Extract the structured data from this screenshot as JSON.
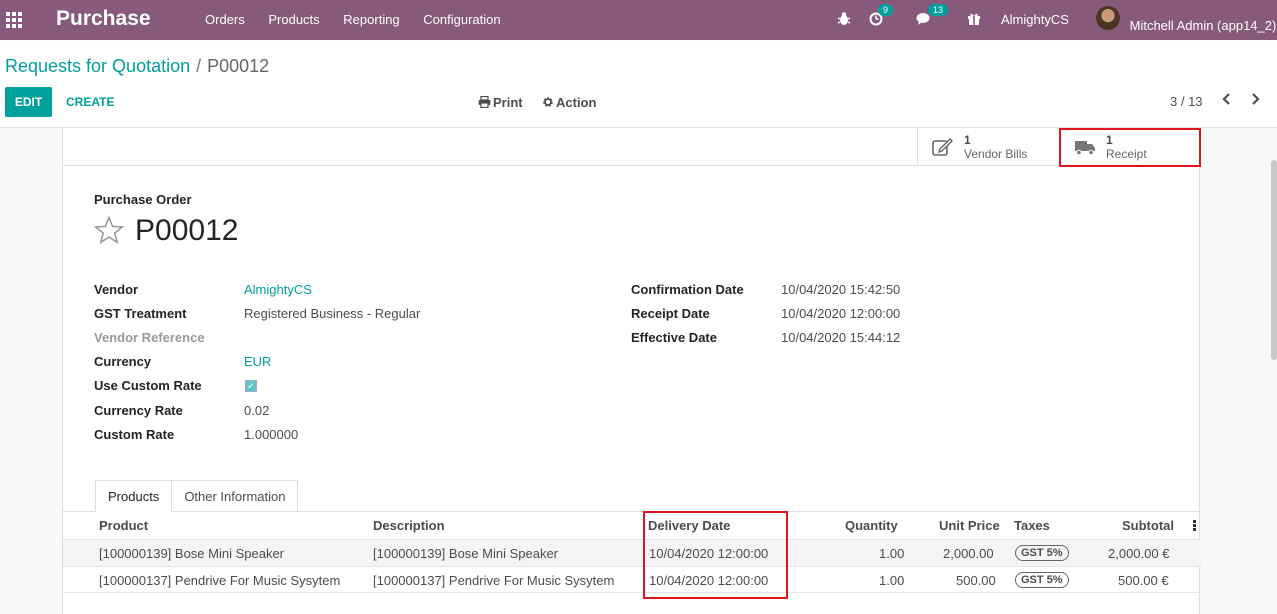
{
  "navbar": {
    "app_name": "Purchase",
    "menu": [
      "Orders",
      "Products",
      "Reporting",
      "Configuration"
    ],
    "activity_badge": "9",
    "messages_badge": "13",
    "company": "AlmightyCS",
    "user": "Mitchell Admin (app14_2)"
  },
  "breadcrumb": {
    "parent": "Requests for Quotation",
    "separator": "/",
    "current": "P00012"
  },
  "toolbar": {
    "edit": "EDIT",
    "create": "CREATE",
    "print": "Print",
    "action": "Action",
    "pager": "3 / 13"
  },
  "smart_buttons": {
    "vendor_bills": {
      "count": "1",
      "label": "Vendor Bills"
    },
    "receipt": {
      "count": "1",
      "label": "Receipt"
    }
  },
  "form": {
    "title_label": "Purchase Order",
    "name": "P00012",
    "left_fields": {
      "vendor": {
        "label": "Vendor",
        "value": "AlmightyCS"
      },
      "gst": {
        "label": "GST Treatment",
        "value": "Registered Business - Regular"
      },
      "vendor_ref": {
        "label": "Vendor Reference",
        "value": ""
      },
      "currency": {
        "label": "Currency",
        "value": "EUR"
      },
      "use_custom_rate": {
        "label": "Use Custom Rate",
        "checked": true
      },
      "currency_rate": {
        "label": "Currency Rate",
        "value": "0.02"
      },
      "custom_rate": {
        "label": "Custom Rate",
        "value": "1.000000"
      }
    },
    "right_fields": {
      "confirmation": {
        "label": "Confirmation Date",
        "value": "10/04/2020 15:42:50"
      },
      "receipt": {
        "label": "Receipt Date",
        "value": "10/04/2020 12:00:00"
      },
      "effective": {
        "label": "Effective Date",
        "value": "10/04/2020 15:44:12"
      }
    }
  },
  "tabs": [
    "Products",
    "Other Information"
  ],
  "table": {
    "headers": {
      "product": "Product",
      "description": "Description",
      "delivery_date": "Delivery Date",
      "quantity": "Quantity",
      "unit_price": "Unit Price",
      "taxes": "Taxes",
      "subtotal": "Subtotal"
    },
    "rows": [
      {
        "product": "[100000139] Bose Mini Speaker",
        "description": "[100000139] Bose Mini Speaker",
        "delivery_date": "10/04/2020 12:00:00",
        "quantity": "1.00",
        "unit_price": "2,000.00",
        "tax": "GST 5%",
        "subtotal": "2,000.00 €"
      },
      {
        "product": "[100000137] Pendrive For Music Sysytem",
        "description": "[100000137] Pendrive For Music Sysytem",
        "delivery_date": "10/04/2020 12:00:00",
        "quantity": "1.00",
        "unit_price": "500.00",
        "tax": "GST 5%",
        "subtotal": "500.00 €"
      }
    ]
  },
  "colors": {
    "navbar": "#875a7b",
    "accent": "#00a09d",
    "highlight": "#e0161d"
  }
}
